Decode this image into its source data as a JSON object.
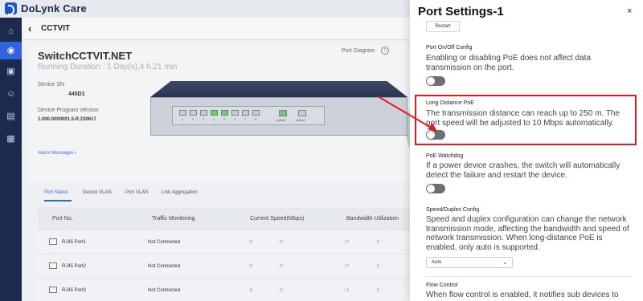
{
  "app": {
    "brand": "DoLynk Care"
  },
  "sidebar": {
    "items": [
      {
        "icon": "home-icon",
        "glyph": "⌂"
      },
      {
        "icon": "location-icon",
        "glyph": "◉",
        "active": true
      },
      {
        "icon": "monitor-icon",
        "glyph": "▣"
      },
      {
        "icon": "users-icon",
        "glyph": "☺"
      },
      {
        "icon": "building-icon",
        "glyph": "▤"
      },
      {
        "icon": "clipboard-icon",
        "glyph": "▦"
      }
    ]
  },
  "breadcrumb": {
    "back": "‹",
    "title": "CCTVIT"
  },
  "device": {
    "name": "SwitchCCTVIT.NET",
    "running": "Running Duration : 1 Day(s),4 h,21 min",
    "sn_label": "Device SN",
    "sn_value": "445D1",
    "version_label": "Device Program Version",
    "version_value": "1.000.0000001.5.R.230617",
    "alarm": "Alarm Messages ›",
    "port_diagram": "Port Diagram",
    "help": "?",
    "right_letter": "R"
  },
  "switch": {
    "ports": [
      "1",
      "2",
      "3",
      "4",
      "5",
      "6",
      "7",
      "8"
    ],
    "green_ports": [
      4,
      5
    ],
    "uplinks": [
      "Uplink1",
      "Uplink2"
    ]
  },
  "tabs": [
    "Port Status",
    "Device VLAN",
    "Port VLAN",
    "Link Aggregation"
  ],
  "table": {
    "headers": [
      "Port No.",
      "Traffic Monitoring",
      "Current Speed(Mbps)",
      "Bandwidth Utilization"
    ],
    "rows": [
      {
        "port": "RJ45 Port1",
        "traffic": "Not Connected",
        "speed_up": "↑ 0",
        "speed_down": "↓ 0",
        "bw_up": "↑ 0",
        "bw_down": "↓ 0"
      },
      {
        "port": "RJ45 Port2",
        "traffic": "Not Connected",
        "speed_up": "↑ 0",
        "speed_down": "↓ 0",
        "bw_up": "↑ 0",
        "bw_down": "↓ 0"
      },
      {
        "port": "RJ45 Port3",
        "traffic": "Not Connected",
        "speed_up": "↑ 0",
        "speed_down": "↓ 0",
        "bw_up": "↑ 0",
        "bw_down": "↓ 0"
      }
    ]
  },
  "panel": {
    "title": "Port Settings-1",
    "close": "×",
    "restart": "Restart",
    "onoff": {
      "title": "Port On/Off Config",
      "desc": "Enabling or disabling PoE does not affect data transmission on the port."
    },
    "long_distance": {
      "title": "Long Distance PoE",
      "desc": "The transmission distance can reach up to 250 m. The port speed will be adjusted to 10 Mbps automatically."
    },
    "watchdog": {
      "title": "PoE Watchdog",
      "desc": "If a power device crashes, the switch will automatically detect the failure and restart the device."
    },
    "speed": {
      "title": "Speed/Duplex Config",
      "desc": "Speed and duplex configuration can change the network transmission mode, affecting the bandwidth and speed of network transmission. When long-distance PoE is enabled, only auto is supported.",
      "select_value": "Auto",
      "chevron": "⌄"
    },
    "flow": {
      "title": "Flow Control",
      "desc": "When flow control is enabled, it notifies sub devices to"
    }
  },
  "colors": {
    "accent": "#2f63e0",
    "highlight": "#e01b24",
    "sidebar": "#1c2a4d"
  }
}
